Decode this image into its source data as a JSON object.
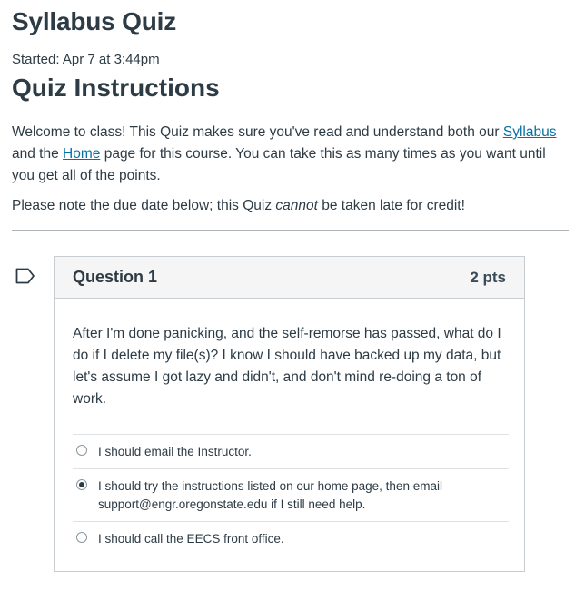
{
  "page": {
    "title": "Syllabus Quiz",
    "started": "Started: Apr 7 at 3:44pm",
    "instructions_title": "Quiz Instructions",
    "intro": {
      "part1": "Welcome to class! This Quiz makes sure you've read and understand both our ",
      "syllabus_link": "Syllabus",
      "part2": " and the ",
      "home_link": "Home",
      "part3": " page for this course. You can take this as many times as you want until you get all of the points."
    },
    "note": {
      "part1": "Please note the due date below; this Quiz ",
      "emphasis": "cannot",
      "part2": " be taken late for credit!"
    }
  },
  "question": {
    "name": "Question 1",
    "points": "2 pts",
    "text": "After I'm done panicking, and the self-remorse has passed, what do I do if I delete my file(s)? I know I should have backed up my data, but let's assume I got lazy and didn't, and don't mind re-doing a ton of work.",
    "answers": [
      {
        "label": "I should email the Instructor.",
        "selected": false
      },
      {
        "label": "I should try the instructions listed on our home page, then email support@engr.oregonstate.edu if I still need help.",
        "selected": true
      },
      {
        "label": "I should call the EECS front office.",
        "selected": false
      }
    ],
    "flag_icon": "flag-outline-icon"
  },
  "colors": {
    "text": "#2d3b45",
    "link": "#0770a3",
    "header_bg": "#f5f5f5",
    "border": "#c7cdd1"
  }
}
